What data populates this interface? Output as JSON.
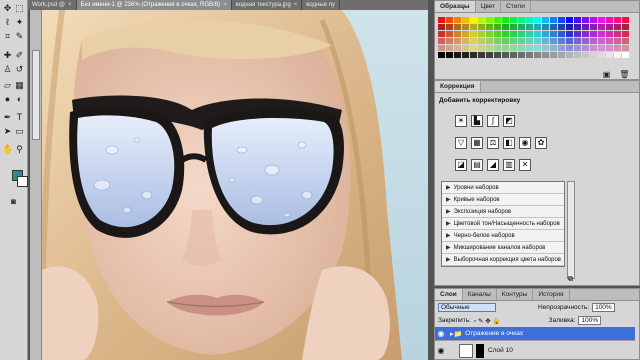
{
  "document_tabs": [
    {
      "label": "Work.psd @",
      "active": false
    },
    {
      "label": "Без имени-1 @ 236% (Отражение в очках, RGB/8)",
      "active": true
    },
    {
      "label": "водная текстура.jpg",
      "active": false
    },
    {
      "label": "водные пу",
      "active": false
    }
  ],
  "swatches_panel": {
    "tabs": [
      "Образцы",
      "Цвет",
      "Стили"
    ]
  },
  "adjustments_panel": {
    "tab": "Коррекция",
    "title": "Добавить корректировку",
    "presets": [
      "Уровни наборов",
      "Кривые наборов",
      "Экспозиция наборов",
      "Цветовой тон/Насыщенность наборов",
      "Черно-белое наборов",
      "Микширование каналов наборов",
      "Выборочная коррекция цвета наборов"
    ]
  },
  "layers_panel": {
    "tabs": [
      "Слои",
      "Каналы",
      "Контуры",
      "История"
    ],
    "blend_mode": "Обычные",
    "opacity_label": "Непрозрачность:",
    "opacity_value": "100%",
    "lock_label": "Закрепить:",
    "fill_label": "Заливка:",
    "fill_value": "100%",
    "layers": [
      {
        "name": "Отражение в очках",
        "type": "group"
      },
      {
        "name": "Слой 10",
        "type": "layer"
      }
    ]
  },
  "colors": {
    "foreground": "#2d8b94",
    "background": "#ffffff",
    "selection": "#3d6fd8",
    "panel_bg": "#d6d6d6"
  },
  "icons": {
    "tools": [
      "move-icon",
      "marquee-icon",
      "lasso-icon",
      "magic-wand-icon",
      "crop-icon",
      "eyedropper-icon",
      "healing-brush-icon",
      "brush-icon",
      "clone-stamp-icon",
      "history-brush-icon",
      "eraser-icon",
      "gradient-icon",
      "blur-icon",
      "dodge-icon",
      "pen-icon",
      "type-icon",
      "path-select-icon",
      "shape-icon",
      "hand-icon",
      "zoom-icon"
    ]
  }
}
